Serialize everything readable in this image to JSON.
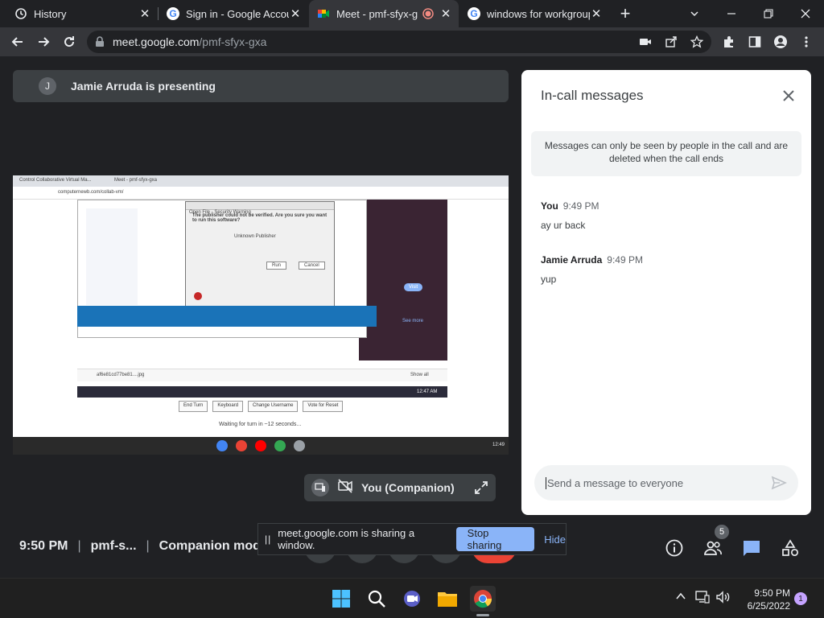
{
  "browser": {
    "tabs": [
      {
        "label": "History",
        "active": false
      },
      {
        "label": "Sign in - Google Accou",
        "active": false
      },
      {
        "label": "Meet - pmf-sfyx-g",
        "active": true
      },
      {
        "label": "windows for workgroup",
        "active": false
      }
    ],
    "url_host": "meet.google.com",
    "url_path": "/pmf-sfyx-gxa"
  },
  "meet": {
    "presenter_initial": "J",
    "presenting_text": "Jamie Arruda is presenting",
    "companion_label": "You (Companion)",
    "time": "9:50 PM",
    "code": "pmf-s...",
    "mode": "Companion mod",
    "participants_count": "5"
  },
  "shared_screen": {
    "tab1": "Control Collaborative Virtual Ma...",
    "tab2": "Meet - pmf-sfyx-gxa",
    "address": "computernewb.com/collab-vm/",
    "dialog_title": "Open File - Security Warning",
    "dialog_question": "The publisher could not be verified. Are you sure you want to run this software?",
    "publisher": "Unknown Publisher",
    "run_label": "Run",
    "cancel_label": "Cancel",
    "download_file": "af6e81cd77be81....jpg",
    "show_all": "Show all",
    "buttons": [
      "End Turn",
      "Keyboard",
      "Change Username",
      "Vote for Reset"
    ],
    "waiting": "Waiting for turn in ~12 seconds...",
    "see_more": "See more",
    "visit": "Visit",
    "taskbar_time": "12:47 AM",
    "shelf_time": "12:49"
  },
  "chat": {
    "title": "In-call messages",
    "notice": "Messages can only be seen by people in the call and are deleted when the call ends",
    "messages": [
      {
        "sender": "You",
        "time": "9:49 PM",
        "text": "ay ur back"
      },
      {
        "sender": "Jamie Arruda",
        "time": "9:49 PM",
        "text": "yup"
      }
    ],
    "placeholder": "Send a message to everyone"
  },
  "sharing_bar": {
    "message": "meet.google.com is sharing a window.",
    "stop_label": "Stop sharing",
    "hide_label": "Hide"
  },
  "taskbar": {
    "time": "9:50 PM",
    "date": "6/25/2022",
    "notifications": "1"
  },
  "colors": {
    "accent": "#8ab4f8",
    "end_call": "#ea4335",
    "chat_icon": "#8ab4f8"
  }
}
